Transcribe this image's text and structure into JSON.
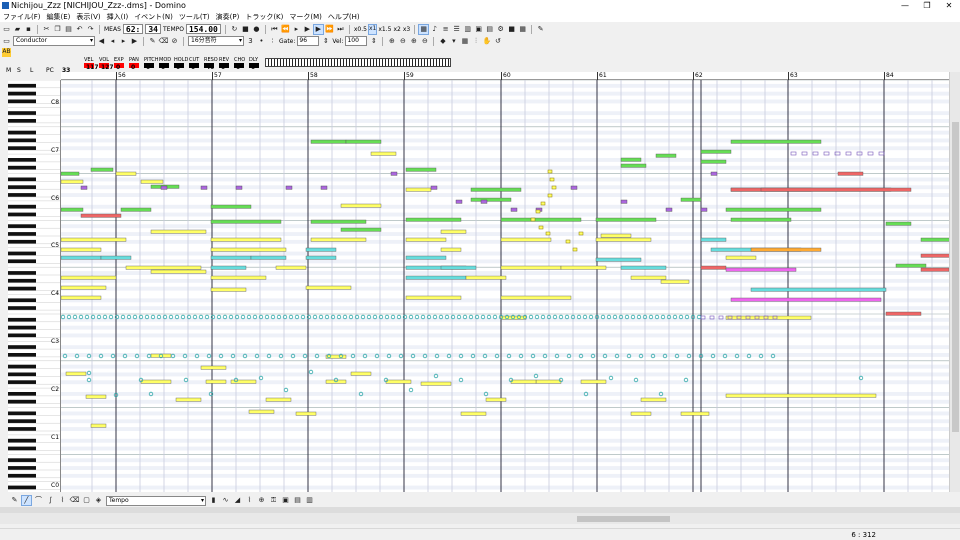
{
  "window": {
    "title": "Nichijou_Zzz [NICHIJOU_Zzz-.dms] - Domino",
    "controls": [
      "—",
      "❐",
      "✕"
    ]
  },
  "menu": [
    "ファイル(F)",
    "編集(E)",
    "表示(V)",
    "挿入(I)",
    "イベント(N)",
    "ツール(T)",
    "演奏(P)",
    "トラック(K)",
    "マーク(M)",
    "ヘルプ(H)"
  ],
  "toolbar1": {
    "meas_label": "MEAS",
    "meas_value": "62:",
    "tick_value": "34",
    "tempo_label": "TEMPO",
    "tempo_value": "154.00",
    "speeds": [
      "x0.5",
      "x1",
      "x1.5",
      "x2",
      "x3"
    ]
  },
  "toolbar2": {
    "track_select": "Conductor",
    "note_select": "16分音符",
    "gate_label": "Gate:",
    "gate_value": "96",
    "vel_label": "Vel:",
    "vel_value": "100"
  },
  "toolbar3": {
    "ab_left": "A",
    "ab_right": "B"
  },
  "control_strip": {
    "labels": [
      "VEL",
      "VOL",
      "EXP",
      "PAN",
      "PITCH",
      "MOD",
      "HOLD",
      "CUT",
      "RESO",
      "REV",
      "CHO",
      "DLY"
    ],
    "values": [
      "117",
      "127",
      "0",
      "0",
      "0",
      "0",
      "0",
      "0",
      "40",
      "0",
      "0",
      "0"
    ],
    "colors": [
      "#ff0000",
      "#ff0000",
      "#ff0000",
      "#ff0000",
      "#000000",
      "#000000",
      "#000000",
      "#000000",
      "#000000",
      "#000000",
      "#000000",
      "#000000"
    ],
    "m_label": "M",
    "s_label": "S",
    "l_label": "L",
    "pc_label": "PC",
    "pc_value": "33"
  },
  "measures": [
    "56",
    "57",
    "58",
    "59",
    "60",
    "61",
    "62",
    "63",
    "84"
  ],
  "octaves": [
    "C8",
    "C7",
    "C6",
    "C5",
    "C4",
    "C3",
    "C2",
    "C1",
    "C0"
  ],
  "bottom": {
    "event_select": "Tempo"
  },
  "status": {
    "position": "6 : 312"
  },
  "colors": {
    "yellow": "#ffff66",
    "green": "#66dd55",
    "cyan": "#66dddd",
    "red": "#ee6666",
    "magenta": "#ee66ee",
    "purple": "#aa66dd",
    "grid_bar": "#333344",
    "grid_beat": "#c8ccdd"
  }
}
